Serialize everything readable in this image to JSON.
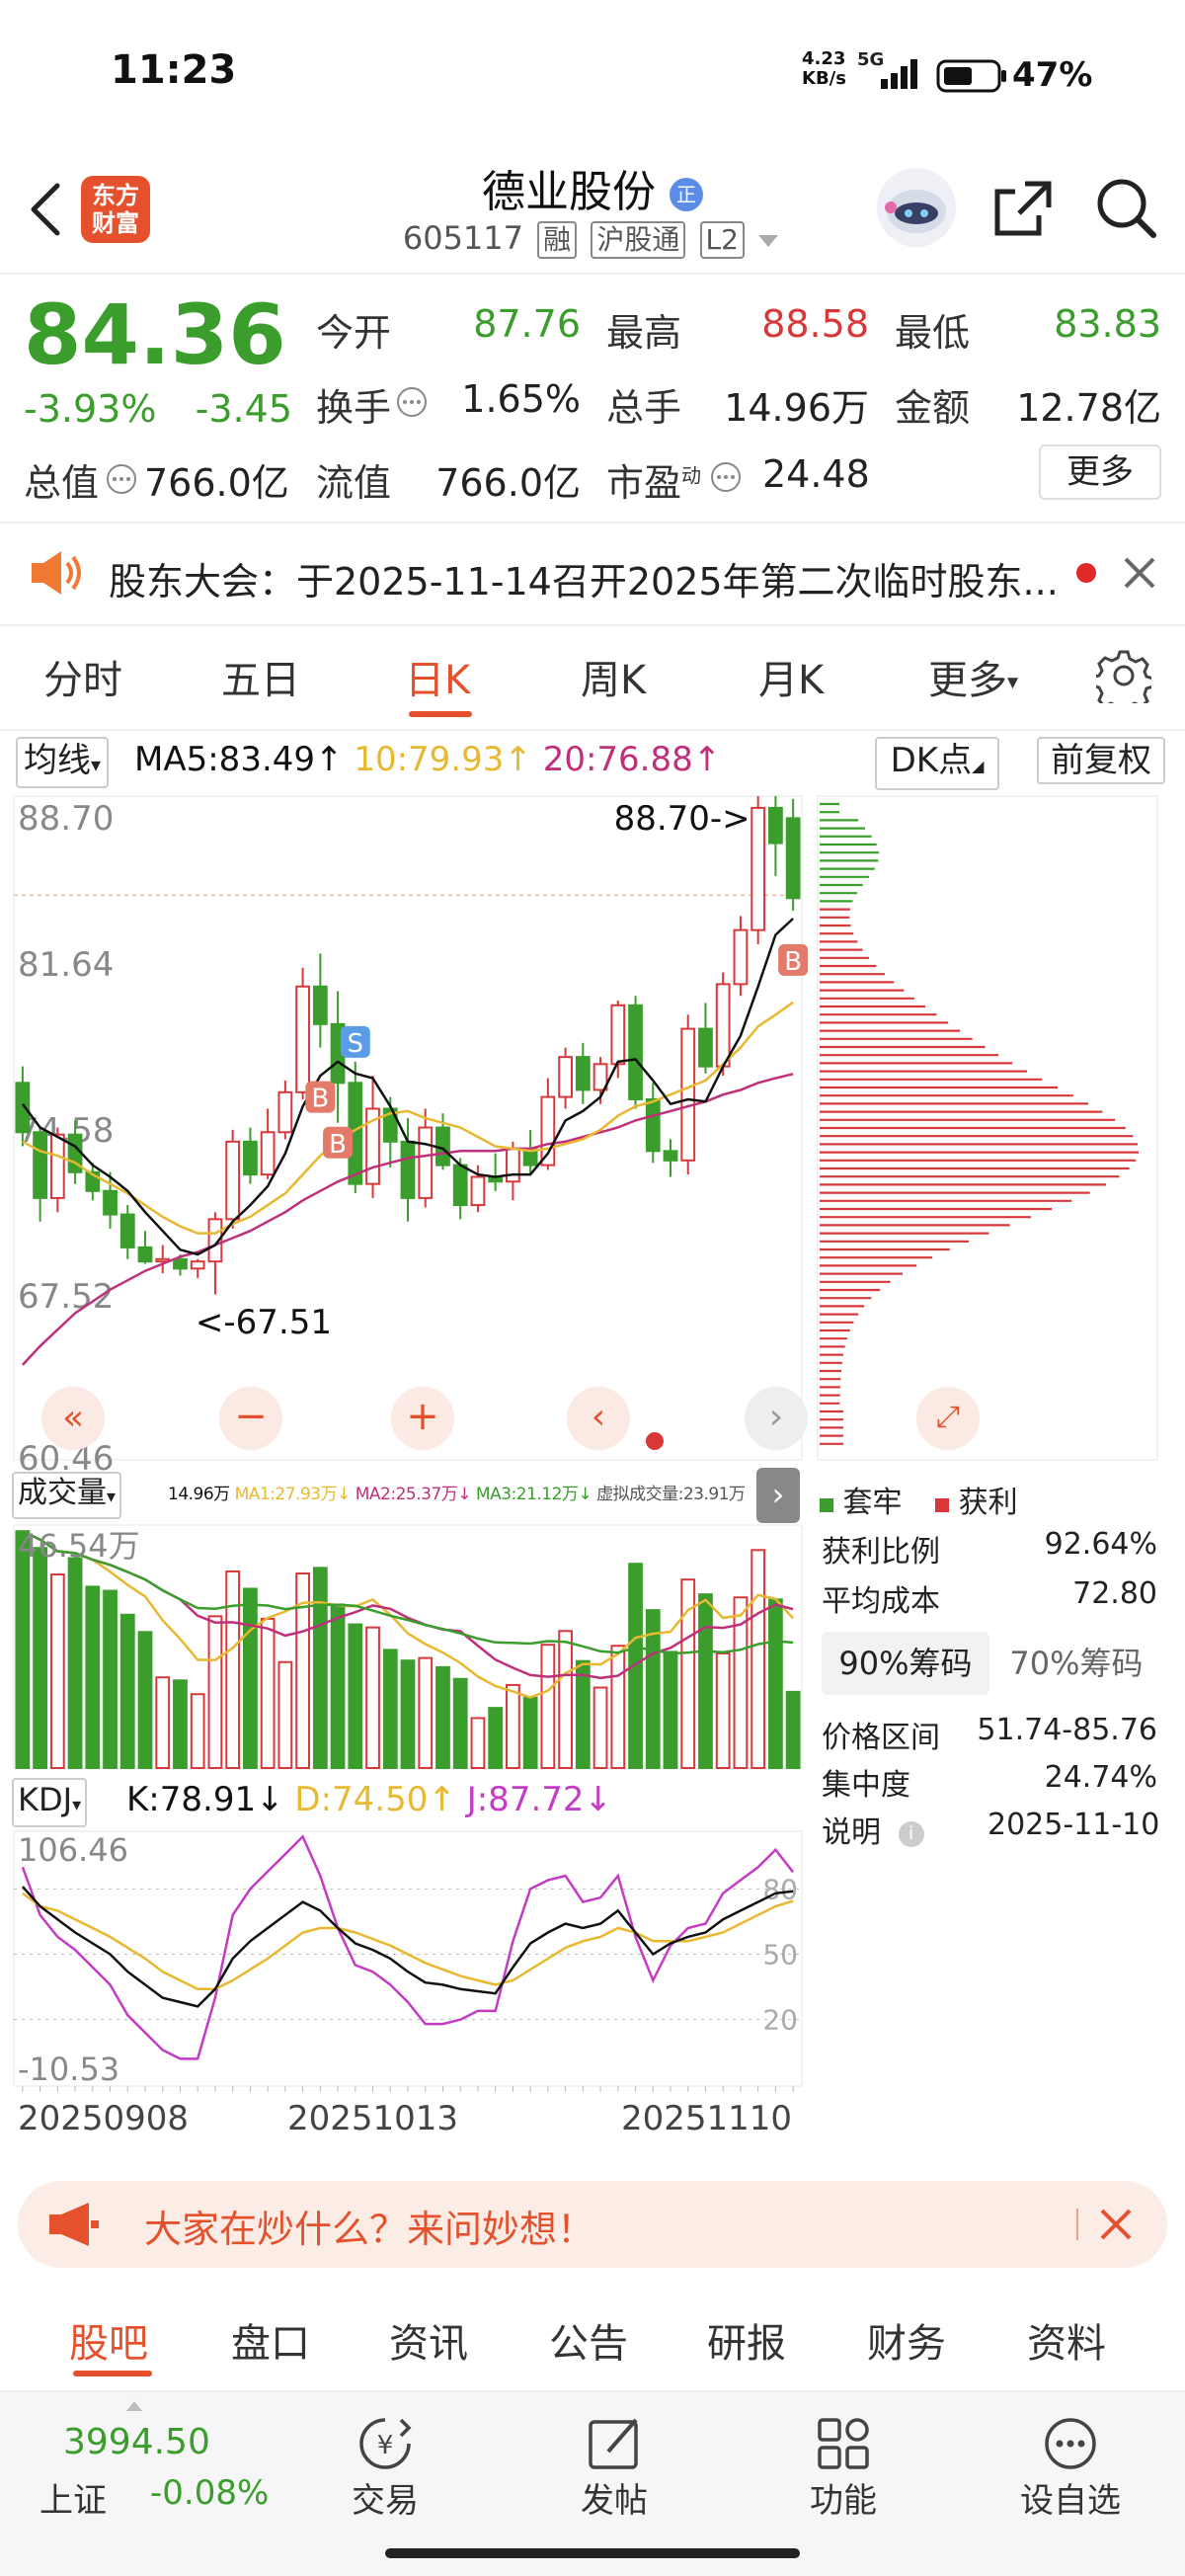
{
  "status": {
    "time": "11:23",
    "net_speed_value": "4.23",
    "net_speed_unit": "KB/s",
    "network": "5G",
    "battery": "47%"
  },
  "header": {
    "stock_name": "德业股份",
    "stock_code": "605117",
    "tag_margin": "融",
    "tag_connect": "沪股通",
    "tag_level": "L2",
    "app_logo_line1": "东方",
    "app_logo_line2": "财富",
    "badge": "正"
  },
  "quote": {
    "price": "84.36",
    "change_pct": "-3.93%",
    "change": "-3.45",
    "open_label": "今开",
    "open": "87.76",
    "high_label": "最高",
    "high": "88.58",
    "low_label": "最低",
    "low": "83.83",
    "turnover_label": "换手",
    "turnover": "1.65%",
    "volume_label": "总手",
    "volume": "14.96万",
    "amount_label": "金额",
    "amount": "12.78亿",
    "mktcap_label": "总值",
    "mktcap": "766.0亿",
    "float_label": "流值",
    "float": "766.0亿",
    "pe_label": "市盈",
    "pe_sup": "动",
    "pe": "24.48",
    "more": "更多"
  },
  "notice": {
    "text": "股东大会：于2025-11-14召开2025年第二次临时股东..."
  },
  "tabs": [
    "分时",
    "五日",
    "日K",
    "周K",
    "月K",
    "更多"
  ],
  "active_tab": "日K",
  "chart_toolbar": {
    "ma_select": "均线",
    "ma5": "MA5:83.49",
    "ma10": "10:79.93",
    "ma20": "20:76.88",
    "dk": "DK点",
    "adjust": "前复权"
  },
  "chart_data": {
    "type": "candlestick",
    "y_ticks": [
      "88.70",
      "81.64",
      "74.58",
      "67.52",
      "60.46"
    ],
    "ylim": [
      60.46,
      88.7
    ],
    "high_label": "88.70->",
    "low_label": "<-67.51",
    "x_ticks": [
      "20250908",
      "20251013",
      "20251110"
    ],
    "colors": {
      "up": "#d9383a",
      "down": "#3a9d2c",
      "ma5": "#111111",
      "ma10": "#e8b830",
      "ma20": "#c0307a"
    },
    "candles_ohlc": [
      [
        76.5,
        77.2,
        73.8,
        74.4
      ],
      [
        74.4,
        74.6,
        70.6,
        71.6
      ],
      [
        71.6,
        74.6,
        71.0,
        74.3
      ],
      [
        74.3,
        74.9,
        72.2,
        72.7
      ],
      [
        72.7,
        73.1,
        71.5,
        71.9
      ],
      [
        71.9,
        72.7,
        70.3,
        70.9
      ],
      [
        70.9,
        71.3,
        69.0,
        69.5
      ],
      [
        69.5,
        70.2,
        68.8,
        68.9
      ],
      [
        68.9,
        69.6,
        68.4,
        69.0
      ],
      [
        69.0,
        69.2,
        68.3,
        68.6
      ],
      [
        68.6,
        69.0,
        68.2,
        68.9
      ],
      [
        68.9,
        71.0,
        67.5,
        70.7
      ],
      [
        70.7,
        74.5,
        70.3,
        74.0
      ],
      [
        74.0,
        74.6,
        72.2,
        72.6
      ],
      [
        72.6,
        75.4,
        72.4,
        74.4
      ],
      [
        74.4,
        76.6,
        74.1,
        76.1
      ],
      [
        76.1,
        81.4,
        75.8,
        80.6
      ],
      [
        80.6,
        82.0,
        78.0,
        79.0
      ],
      [
        79.0,
        80.4,
        74.8,
        76.5
      ],
      [
        76.5,
        77.4,
        71.8,
        72.2
      ],
      [
        72.2,
        76.8,
        71.6,
        75.4
      ],
      [
        75.4,
        75.9,
        72.9,
        74.0
      ],
      [
        74.0,
        75.0,
        70.6,
        71.6
      ],
      [
        71.6,
        75.4,
        71.2,
        74.6
      ],
      [
        74.6,
        75.2,
        72.8,
        73.0
      ],
      [
        73.0,
        73.3,
        70.7,
        71.3
      ],
      [
        71.3,
        73.0,
        71.0,
        72.5
      ],
      [
        72.5,
        73.5,
        71.9,
        72.3
      ],
      [
        72.3,
        74.0,
        71.5,
        73.7
      ],
      [
        73.7,
        74.5,
        72.6,
        73.0
      ],
      [
        73.0,
        76.7,
        72.8,
        75.9
      ],
      [
        75.9,
        78.0,
        75.4,
        77.6
      ],
      [
        77.6,
        78.2,
        75.6,
        76.2
      ],
      [
        76.2,
        77.6,
        75.6,
        77.3
      ],
      [
        77.3,
        80.0,
        76.7,
        79.8
      ],
      [
        79.8,
        80.2,
        75.4,
        75.8
      ],
      [
        75.8,
        76.5,
        73.1,
        73.6
      ],
      [
        73.6,
        74.1,
        72.5,
        73.2
      ],
      [
        73.2,
        79.4,
        72.6,
        78.8
      ],
      [
        78.8,
        79.9,
        76.9,
        77.2
      ],
      [
        77.2,
        81.2,
        76.8,
        80.7
      ],
      [
        80.7,
        83.6,
        80.2,
        83.0
      ],
      [
        83.0,
        88.7,
        82.4,
        88.2
      ],
      [
        88.2,
        88.7,
        85.3,
        86.7
      ],
      [
        87.76,
        88.58,
        83.83,
        84.36
      ]
    ],
    "ma5": [
      75.6,
      74.6,
      74.2,
      73.8,
      73.0,
      72.5,
      71.9,
      71.0,
      70.2,
      69.4,
      69.2,
      69.6,
      70.6,
      71.3,
      72.1,
      73.5,
      75.5,
      76.8,
      77.4,
      76.9,
      76.7,
      75.5,
      74.0,
      73.9,
      73.7,
      73.0,
      72.6,
      72.5,
      72.6,
      72.6,
      73.5,
      74.9,
      75.3,
      75.9,
      77.4,
      77.5,
      76.6,
      75.6,
      75.8,
      75.7,
      77.2,
      78.5,
      80.6,
      82.8,
      83.49
    ],
    "ma10": [
      74.0,
      73.6,
      73.4,
      73.1,
      72.6,
      72.2,
      71.8,
      71.3,
      70.8,
      70.4,
      70.1,
      70.1,
      70.5,
      70.8,
      71.3,
      71.8,
      72.6,
      73.4,
      74.0,
      74.5,
      74.9,
      75.2,
      75.3,
      75.0,
      74.8,
      74.6,
      74.2,
      73.8,
      73.7,
      73.6,
      73.7,
      73.9,
      74.1,
      74.5,
      75.1,
      75.5,
      75.7,
      76.0,
      76.3,
      76.6,
      77.3,
      78.0,
      78.9,
      79.4,
      79.93
    ],
    "ma20": [
      64.5,
      65.3,
      66.0,
      66.7,
      67.2,
      67.7,
      68.1,
      68.5,
      68.8,
      69.1,
      69.3,
      69.6,
      69.9,
      70.2,
      70.6,
      71.0,
      71.5,
      71.9,
      72.3,
      72.6,
      72.9,
      73.1,
      73.3,
      73.4,
      73.5,
      73.6,
      73.6,
      73.6,
      73.7,
      73.7,
      73.9,
      74.0,
      74.2,
      74.4,
      74.6,
      74.9,
      75.1,
      75.3,
      75.5,
      75.7,
      76.0,
      76.2,
      76.5,
      76.7,
      76.88
    ],
    "signals": [
      {
        "label": "B",
        "type": "buy",
        "index": 17
      },
      {
        "label": "S",
        "type": "sell",
        "index": 19
      },
      {
        "label": "B",
        "type": "buy",
        "index": 18
      },
      {
        "label": "B",
        "type": "buy",
        "index": 44
      }
    ]
  },
  "chip_panel": {
    "legend_trapped": "套牢",
    "legend_profit": "获利",
    "profit_ratio_label": "获利比例",
    "profit_ratio": "92.64%",
    "avg_cost_label": "平均成本",
    "avg_cost": "72.80",
    "tab_90": "90%筹码",
    "tab_70": "70%筹码",
    "price_range_label": "价格区间",
    "price_range": "51.74-85.76",
    "concentration_label": "集中度",
    "concentration": "24.74%",
    "note_label": "说明",
    "note_date": "2025-11-10"
  },
  "volume": {
    "select": "成交量",
    "total": "14.96万",
    "ma1": "MA1:27.93万",
    "ma2": "MA2:25.37万",
    "ma3": "MA3:21.12万",
    "virtual": "虚拟成交量:23.91万",
    "max_label": "46.54万",
    "values": [
      46.5,
      43.2,
      38.0,
      41.2,
      35.6,
      34.8,
      30.1,
      26.7,
      17.8,
      17.2,
      14.5,
      29.8,
      38.6,
      35.2,
      29.3,
      20.8,
      38.2,
      39.3,
      32.1,
      28.2,
      27.6,
      23.2,
      21.1,
      21.6,
      19.8,
      17.5,
      9.8,
      11.8,
      16.3,
      13.8,
      24.2,
      26.9,
      21.0,
      15.8,
      24.0,
      40.1,
      31.0,
      22.8,
      37.0,
      34.1,
      22.5,
      33.5,
      42.8,
      33.1,
      14.96
    ]
  },
  "kdj": {
    "select": "KDJ",
    "k": "K:78.91",
    "d": "D:74.50",
    "j": "J:87.72",
    "top_label": "106.46",
    "bottom_label": "-10.53",
    "levels": [
      "80",
      "50",
      "20"
    ],
    "k_values": [
      81,
      72,
      66,
      60,
      55,
      50,
      42,
      36,
      30,
      28,
      26,
      34,
      48,
      56,
      62,
      68,
      74,
      70,
      62,
      55,
      52,
      48,
      42,
      37,
      36,
      34,
      33,
      32,
      44,
      55,
      60,
      64,
      62,
      64,
      70,
      60,
      50,
      55,
      58,
      60,
      66,
      70,
      74,
      78,
      78.91
    ],
    "d_values": [
      78,
      72,
      70,
      66,
      62,
      58,
      53,
      48,
      42,
      38,
      34,
      34,
      38,
      43,
      48,
      54,
      60,
      62,
      62,
      60,
      57,
      54,
      50,
      46,
      43,
      40,
      38,
      36,
      38,
      43,
      48,
      53,
      56,
      58,
      62,
      60,
      56,
      56,
      56,
      58,
      60,
      64,
      68,
      72,
      74.5
    ],
    "j_values": [
      90,
      68,
      58,
      52,
      44,
      36,
      22,
      14,
      6,
      2,
      2,
      30,
      68,
      80,
      88,
      96,
      104,
      86,
      62,
      45,
      42,
      36,
      28,
      18,
      18,
      20,
      24,
      24,
      56,
      80,
      84,
      86,
      74,
      76,
      86,
      58,
      38,
      54,
      62,
      64,
      78,
      84,
      90,
      98,
      87.72
    ]
  },
  "banner": {
    "text": "大家在炒什么？来问妙想！"
  },
  "bottom_tabs": [
    "股吧",
    "盘口",
    "资讯",
    "公告",
    "研报",
    "财务",
    "资料"
  ],
  "active_bottom_tab": "股吧",
  "dock": {
    "index_value": "3994.50",
    "index_name": "上证",
    "index_change": "-0.08%",
    "items": [
      "交易",
      "发帖",
      "功能",
      "设自选"
    ]
  }
}
